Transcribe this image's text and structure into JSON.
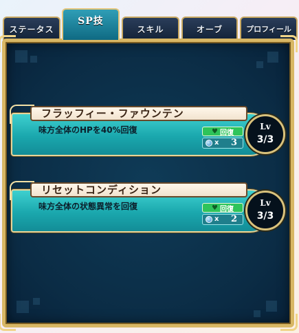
{
  "tabs": [
    {
      "label": "ステータス",
      "active": false
    },
    {
      "label": "SP技",
      "active": true
    },
    {
      "label": "スキル",
      "active": false
    },
    {
      "label": "オーブ",
      "active": false
    },
    {
      "label": "プロフィール",
      "active": false
    }
  ],
  "skills": [
    {
      "name": "フラッフィー・ファウンテン",
      "description": "味方全体のHPを40%回復",
      "type_label": "回復",
      "type_icon": "heart-icon",
      "count_prefix": "x",
      "count": "3",
      "level_label": "Lv",
      "level_value": "3/3"
    },
    {
      "name": "リセットコンディション",
      "description": "味方全体の状態異常を回復",
      "type_label": "回復",
      "type_icon": "heart-icon",
      "count_prefix": "x",
      "count": "2",
      "level_label": "Lv",
      "level_value": "3/3"
    }
  ],
  "colors": {
    "frame_gold": "#d8b764",
    "panel_bg": "#0b2c45",
    "card_teal": "#1aa7ad",
    "badge_green": "#2ec45a"
  }
}
